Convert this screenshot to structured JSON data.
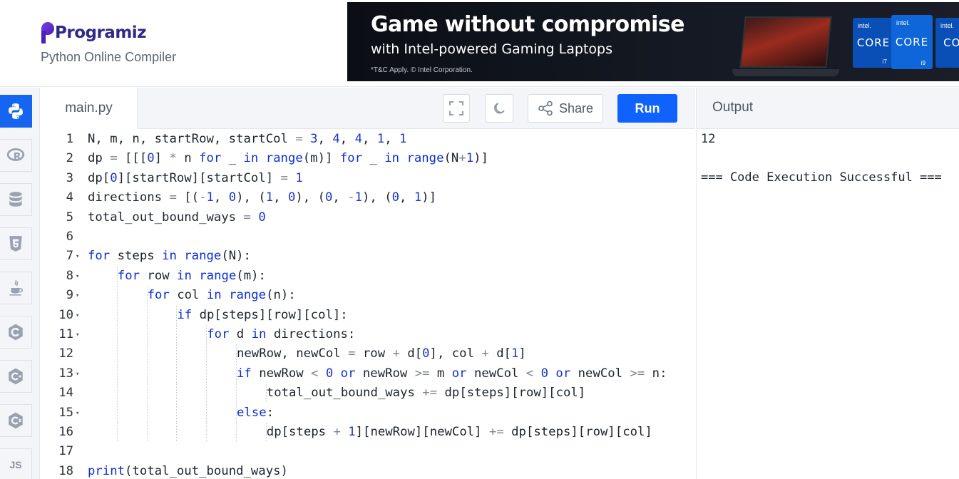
{
  "header": {
    "logo_text": "Programiz",
    "subtitle": "Python Online Compiler"
  },
  "ad": {
    "title": "Game without compromise",
    "subtitle": "with Intel-powered Gaming Laptops",
    "fine_print": "*T&C Apply. © Intel Corporation.",
    "badges": [
      {
        "brand": "intel.",
        "core": "CORE",
        "gen": "i7"
      },
      {
        "brand": "intel.",
        "core": "CORE",
        "gen": "i9"
      },
      {
        "brand": "intel.",
        "core": "COR",
        "gen": ""
      }
    ]
  },
  "sidebar": {
    "languages": [
      {
        "name": "python",
        "active": true
      },
      {
        "name": "r"
      },
      {
        "name": "sql"
      },
      {
        "name": "html"
      },
      {
        "name": "java"
      },
      {
        "name": "c"
      },
      {
        "name": "cpp"
      },
      {
        "name": "csharp"
      },
      {
        "name": "js",
        "label": "JS"
      }
    ]
  },
  "editor": {
    "file_tab": "main.py",
    "share_label": "Share",
    "run_label": "Run"
  },
  "code_lines": [
    {
      "n": "1",
      "fold": false,
      "indent": 0,
      "text": "N, m, n, startRow, startCol = 3, 4, 4, 1, 1"
    },
    {
      "n": "2",
      "fold": false,
      "indent": 0,
      "text": "dp = [[[0] * n for _ in range(m)] for _ in range(N+1)]"
    },
    {
      "n": "3",
      "fold": false,
      "indent": 0,
      "text": "dp[0][startRow][startCol] = 1"
    },
    {
      "n": "4",
      "fold": false,
      "indent": 0,
      "text": "directions = [(-1, 0), (1, 0), (0, -1), (0, 1)]"
    },
    {
      "n": "5",
      "fold": false,
      "indent": 0,
      "text": "total_out_bound_ways = 0"
    },
    {
      "n": "6",
      "fold": false,
      "indent": 0,
      "text": ""
    },
    {
      "n": "7",
      "fold": true,
      "indent": 0,
      "text": "for steps in range(N):"
    },
    {
      "n": "8",
      "fold": true,
      "indent": 1,
      "text": "for row in range(m):"
    },
    {
      "n": "9",
      "fold": true,
      "indent": 2,
      "text": "for col in range(n):"
    },
    {
      "n": "10",
      "fold": true,
      "indent": 3,
      "text": "if dp[steps][row][col]:"
    },
    {
      "n": "11",
      "fold": true,
      "indent": 4,
      "text": "for d in directions:"
    },
    {
      "n": "12",
      "fold": false,
      "indent": 5,
      "text": "newRow, newCol = row + d[0], col + d[1]"
    },
    {
      "n": "13",
      "fold": true,
      "indent": 5,
      "text": "if newRow < 0 or newRow >= m or newCol < 0 or newCol >= n:"
    },
    {
      "n": "14",
      "fold": false,
      "indent": 6,
      "text": "total_out_bound_ways += dp[steps][row][col]"
    },
    {
      "n": "15",
      "fold": true,
      "indent": 5,
      "text": "else:"
    },
    {
      "n": "16",
      "fold": false,
      "indent": 6,
      "text": "dp[steps + 1][newRow][newCol] += dp[steps][row][col]"
    },
    {
      "n": "17",
      "fold": false,
      "indent": 0,
      "text": ""
    },
    {
      "n": "18",
      "fold": false,
      "indent": 0,
      "text": "print(total_out_bound_ways)"
    }
  ],
  "output": {
    "title": "Output",
    "lines": [
      "12",
      "",
      "=== Code Execution Successful ==="
    ]
  }
}
